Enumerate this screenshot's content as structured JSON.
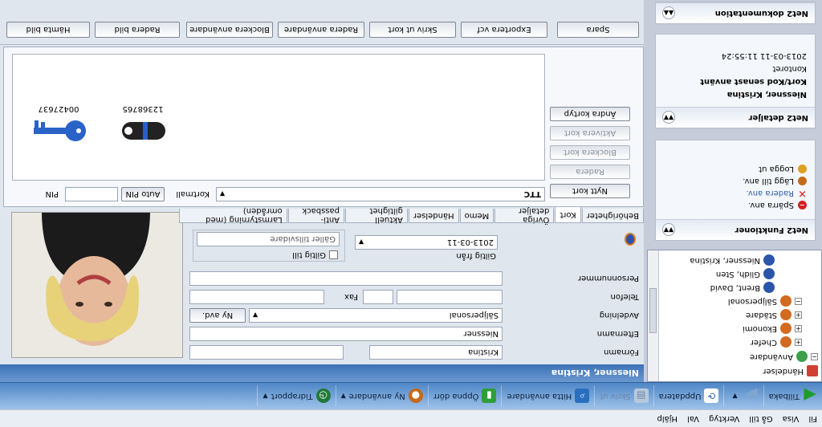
{
  "menu": [
    "Fil",
    "Visa",
    "Gå till",
    "Verktyg",
    "Val",
    "Hjälp"
  ],
  "toolbar": {
    "back": "Tillbaka",
    "refresh": "Uppdatera",
    "print": "Skriv ut",
    "find_users": "Hitta användare",
    "open_door": "Öppna dörr",
    "new_user": "Ny användare",
    "time_report": "Tidrapport"
  },
  "tree": {
    "items": [
      {
        "label": "Händelser",
        "level": 0
      },
      {
        "label": "Användare",
        "level": 0
      },
      {
        "label": "Chefer",
        "level": 1
      },
      {
        "label": "Ekonomi",
        "level": 1
      },
      {
        "label": "Städare",
        "level": 1
      },
      {
        "label": "Säljpersonal",
        "level": 1
      },
      {
        "label": "Brent, David",
        "level": 2
      },
      {
        "label": "Glidh, Sten",
        "level": 2
      },
      {
        "label": "Niessner, Kristina",
        "level": 2
      }
    ]
  },
  "panels": {
    "functions": {
      "title": "Net2 Funktioner",
      "items": [
        "Spärra anv.",
        "Radera anv.",
        "Lägg till anv.",
        "Logga ut"
      ]
    },
    "details": {
      "title": "Net2 detaljer",
      "lines": [
        "Niessner, Kristina",
        "Kort/Kod senast använt",
        "Kontoret",
        "2013-03-11 11:55:24"
      ]
    },
    "docs": {
      "title": "Net2 dokumentation"
    }
  },
  "header": {
    "user_name": "Niessner, Kristina"
  },
  "form": {
    "first_name_label": "Förnamn",
    "first_name": "Kristina",
    "last_name_label": "Efternamn",
    "last_name": "Niessner",
    "department_label": "Avdelning",
    "department": "Säljpersonal",
    "new_dept": "Ny avd.",
    "phone_label": "Telefon",
    "fax_label": "Fax",
    "personnummer_label": "Personnummer",
    "valid_from_label": "Giltig från",
    "valid_from": "2013-03-11",
    "valid_to_label": "Giltig till",
    "valid_to": "Gäller tillsvidare"
  },
  "tabs": [
    "Behörigheter",
    "Kort",
    "Övriga detaljer",
    "Memo",
    "Händelser",
    "Aktuell giltighet",
    "Anti-passback",
    "Larmstyrning (med områden)"
  ],
  "keys": {
    "card1": "00427637",
    "card2": "12368765"
  },
  "pin": {
    "pin_label": "PIN",
    "auto_pin": "Auto PIN",
    "format_label": "Kortmall",
    "format_value": "TTC"
  },
  "card_buttons": {
    "new_card": "Nytt kort",
    "delete": "Radera",
    "block_card": "Blockera kort",
    "activate_card": "Aktivera kort",
    "change_format": "Ändra kortyp"
  },
  "actions": [
    "Hämta bild",
    "Radera bild",
    "Blockera användare",
    "Radera användare",
    "Skriv ut kort",
    "Exportera vcf",
    "Spara"
  ]
}
